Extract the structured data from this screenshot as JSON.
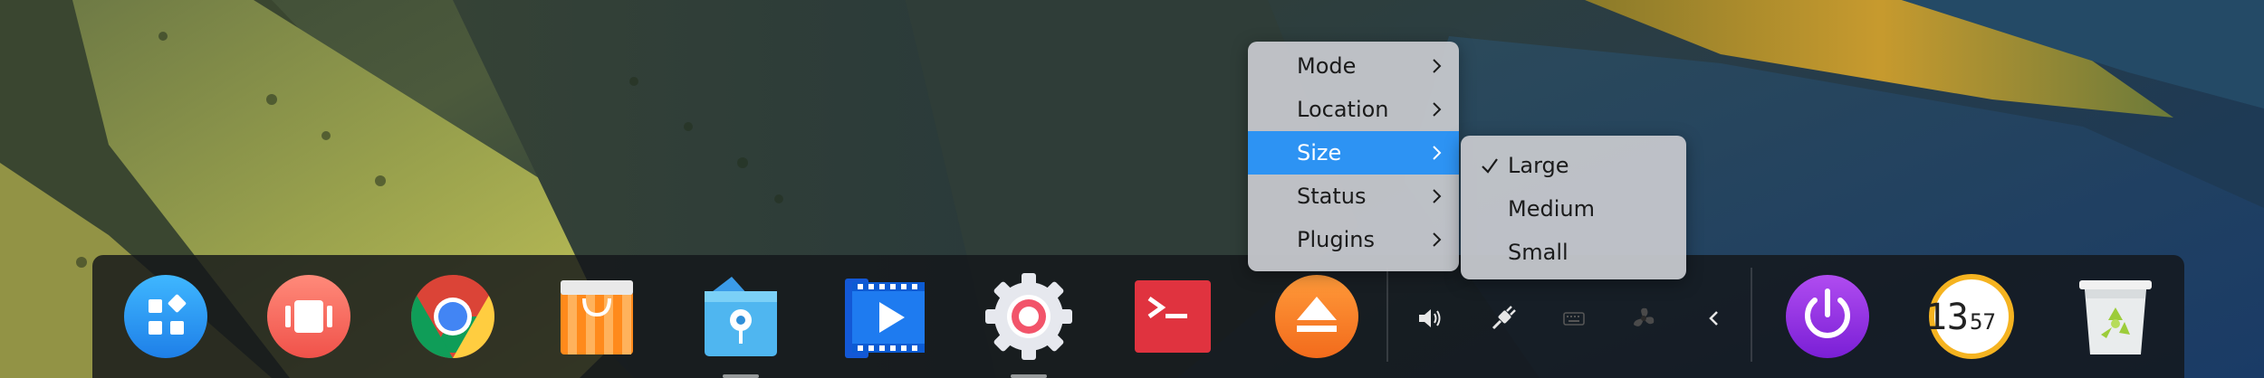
{
  "context_menu": {
    "items": [
      {
        "label": "Mode",
        "has_submenu": true
      },
      {
        "label": "Location",
        "has_submenu": true
      },
      {
        "label": "Size",
        "has_submenu": true,
        "highlighted": true
      },
      {
        "label": "Status",
        "has_submenu": true
      },
      {
        "label": "Plugins",
        "has_submenu": true
      }
    ],
    "highlight_color": "#2d93f3"
  },
  "size_submenu": {
    "items": [
      {
        "label": "Large",
        "checked": true
      },
      {
        "label": "Medium",
        "checked": false
      },
      {
        "label": "Small",
        "checked": false
      }
    ]
  },
  "dock": {
    "apps": [
      {
        "name": "launcher",
        "icon": "launcher-grid-icon"
      },
      {
        "name": "multitasking-view",
        "icon": "multitasking-icon"
      },
      {
        "name": "chrome",
        "icon": "chrome-icon"
      },
      {
        "name": "app-store",
        "icon": "app-store-bag-icon"
      },
      {
        "name": "file-manager",
        "icon": "file-manager-icon",
        "running": true
      },
      {
        "name": "movie-player",
        "icon": "movie-player-icon"
      },
      {
        "name": "control-center",
        "icon": "settings-gear-icon",
        "running": true
      },
      {
        "name": "terminal",
        "icon": "terminal-icon"
      },
      {
        "name": "eject",
        "icon": "eject-icon"
      }
    ],
    "tray": [
      {
        "name": "volume",
        "icon": "volume-icon"
      },
      {
        "name": "network",
        "icon": "network-plug-icon"
      },
      {
        "name": "keyboard",
        "icon": "keyboard-icon"
      },
      {
        "name": "tray-app",
        "icon": "fan-icon"
      },
      {
        "name": "collapse",
        "icon": "chevron-left-icon"
      }
    ],
    "right": [
      {
        "name": "shutdown",
        "icon": "power-icon"
      },
      {
        "name": "clock",
        "icon": "clock-icon",
        "time_hours": "13",
        "time_minutes": "57"
      },
      {
        "name": "trash",
        "icon": "trash-bin-icon"
      }
    ]
  }
}
